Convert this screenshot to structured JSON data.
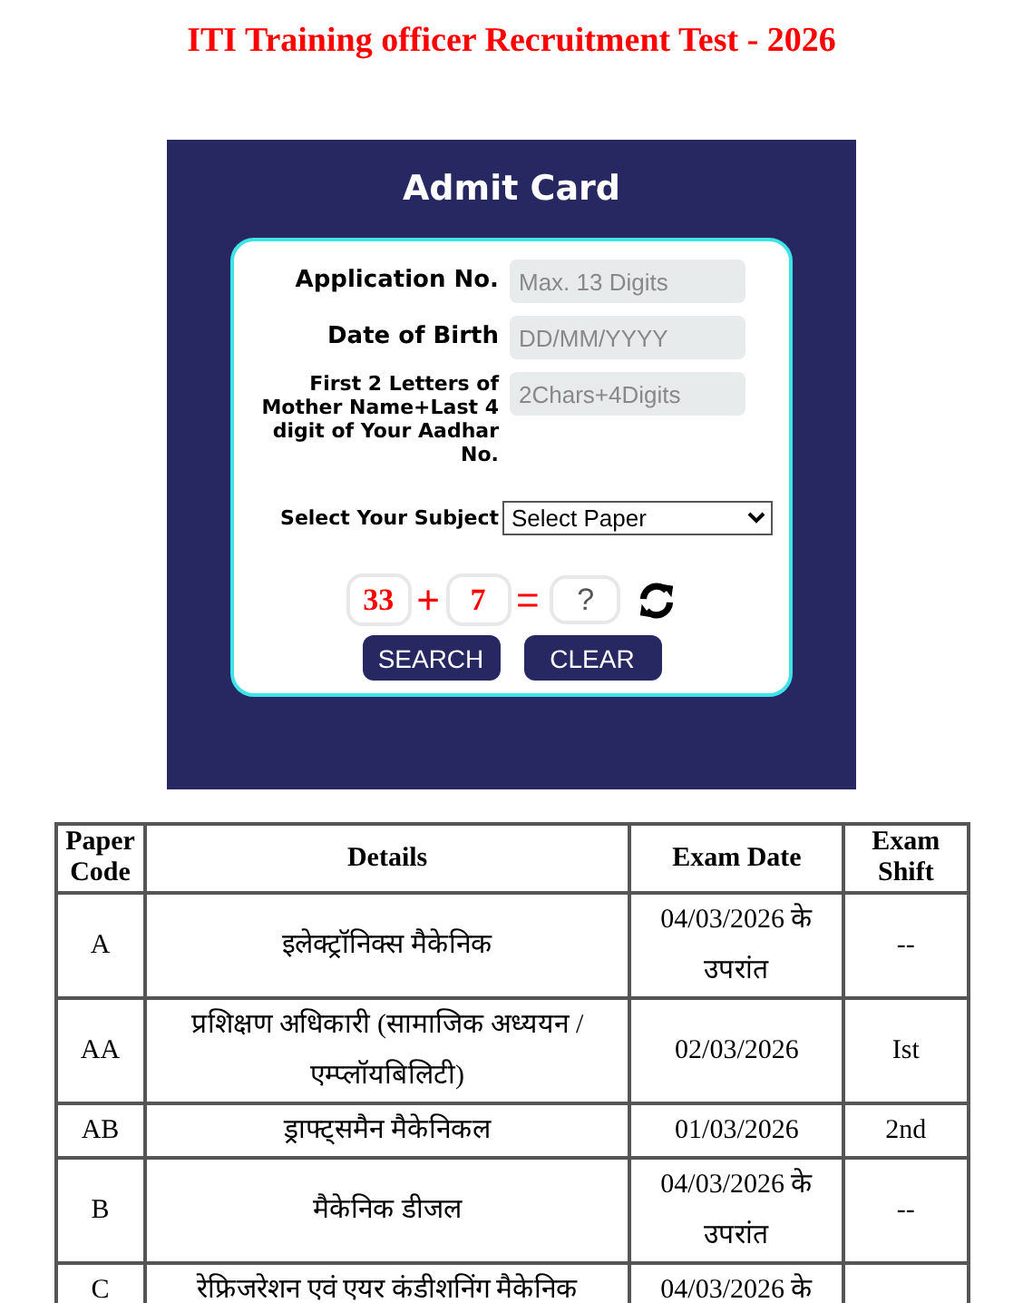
{
  "title": "ITI Training officer Recruitment Test - 2026",
  "admit_card": {
    "heading": "Admit Card",
    "fields": [
      {
        "label": "Application No.",
        "placeholder": "Max. 13 Digits"
      },
      {
        "label": "Date of Birth",
        "placeholder": "DD/MM/YYYY"
      },
      {
        "label": "First 2 Letters of Mother Name+Last 4 digit of Your Aadhar No.",
        "placeholder": "2Chars+4Digits"
      }
    ],
    "subject": {
      "label": "Select Your Subject",
      "value": "Select Paper"
    },
    "captcha": {
      "first": "33",
      "operator": "+",
      "second": "7",
      "equals": "=",
      "placeholder": "?"
    },
    "buttons": [
      "SEARCH",
      "CLEAR"
    ]
  },
  "table": {
    "columns": [
      "Paper Code",
      "Details",
      "Exam Date",
      "Exam Shift"
    ],
    "rows": [
      [
        "A",
        "इलेक्ट्रॉनिक्स मैकेनिक",
        "04/03/2026 के उपरांत",
        "--"
      ],
      [
        "AA",
        "प्रशिक्षण अधिकारी (सामाजिक अध्ययन / एम्प्लॉयबिलिटी)",
        "02/03/2026",
        "Ist"
      ],
      [
        "AB",
        "ड्राफ्ट्समैन मैकेनिकल",
        "01/03/2026",
        "2nd"
      ],
      [
        "B",
        "मैकेनिक डीजल",
        "04/03/2026 के उपरांत",
        "--"
      ],
      [
        "C",
        "रेफ्रिजरेशन एवं एयर कंडीशनिंग मैकेनिक",
        "04/03/2026 के"
      ]
    ]
  }
}
